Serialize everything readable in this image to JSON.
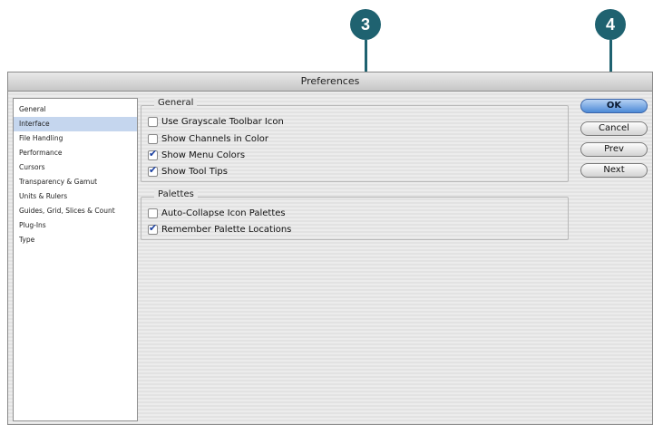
{
  "callouts": {
    "step_3": "3",
    "step_4": "4"
  },
  "window": {
    "title": "Preferences"
  },
  "sidebar": {
    "items": [
      {
        "label": "General"
      },
      {
        "label": "Interface",
        "selected": true
      },
      {
        "label": "File Handling"
      },
      {
        "label": "Performance"
      },
      {
        "label": "Cursors"
      },
      {
        "label": "Transparency & Gamut"
      },
      {
        "label": "Units & Rulers"
      },
      {
        "label": "Guides, Grid, Slices & Count"
      },
      {
        "label": "Plug-Ins"
      },
      {
        "label": "Type"
      }
    ]
  },
  "general": {
    "title": "General",
    "options": [
      {
        "label": "Use Grayscale Toolbar Icon",
        "checked": false
      },
      {
        "label": "Show Channels in Color",
        "checked": false
      },
      {
        "label": "Show Menu Colors",
        "checked": true
      },
      {
        "label": "Show Tool Tips",
        "checked": true
      }
    ]
  },
  "palettes": {
    "title": "Palettes",
    "options": [
      {
        "label": "Auto-Collapse Icon Palettes",
        "checked": false
      },
      {
        "label": "Remember Palette Locations",
        "checked": true
      }
    ]
  },
  "buttons": {
    "ok": "OK",
    "cancel": "Cancel",
    "prev": "Prev",
    "next": "Next"
  },
  "colors": {
    "callout": "#1f6270",
    "selection": "#c5d6ee",
    "default_button": "#4d8ad6"
  }
}
